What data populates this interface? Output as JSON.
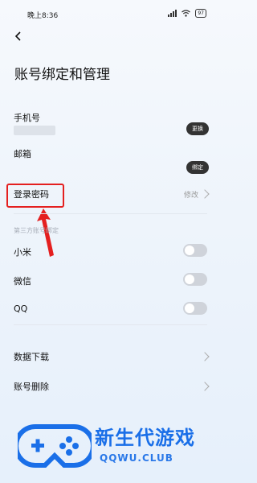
{
  "status_bar": {
    "time": "晚上8:36",
    "battery": "97"
  },
  "page": {
    "title": "账号绑定和管理"
  },
  "phone": {
    "label": "手机号",
    "button": "更换"
  },
  "email": {
    "label": "邮箱",
    "button": "绑定"
  },
  "password": {
    "label": "登录密码",
    "action": "修改"
  },
  "third_party": {
    "section_label": "第三方账号绑定",
    "items": [
      {
        "label": "小米",
        "enabled": false
      },
      {
        "label": "微信",
        "enabled": false
      },
      {
        "label": "QQ",
        "enabled": false
      }
    ]
  },
  "more": [
    {
      "label": "数据下载"
    },
    {
      "label": "账号删除"
    }
  ],
  "watermark": {
    "brand": "新生代游戏",
    "url": "QQWU.CLUB"
  },
  "colors": {
    "highlight": "#e41f1f",
    "brand": "#1a6fe8"
  }
}
